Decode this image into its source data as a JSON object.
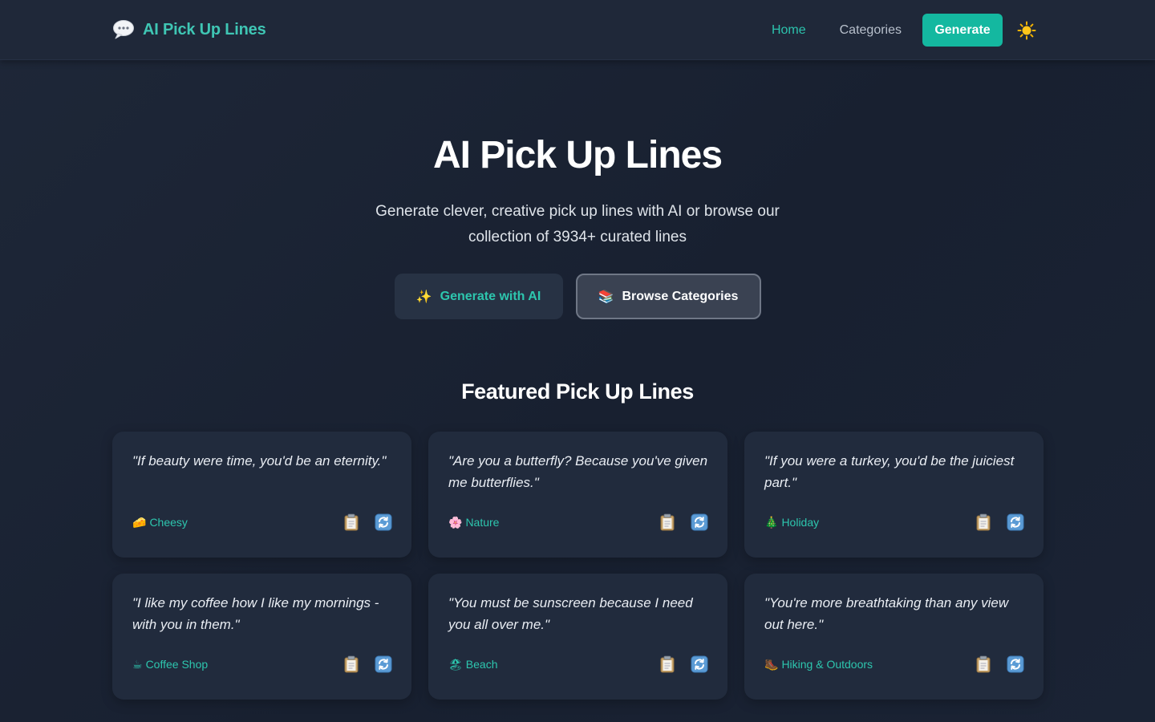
{
  "header": {
    "brand_title": "AI Pick Up Lines",
    "brand_icon": "speech-bubble-icon",
    "nav": {
      "home": "Home",
      "categories": "Categories",
      "generate": "Generate"
    },
    "theme_icon": "sun-icon"
  },
  "hero": {
    "title": "AI Pick Up Lines",
    "subtitle": "Generate clever, creative pick up lines with AI or browse our collection of 3934+ curated lines",
    "generate_button": {
      "icon": "✨",
      "label": "Generate with AI"
    },
    "browse_button": {
      "icon": "📚",
      "label": "Browse Categories"
    }
  },
  "featured": {
    "title": "Featured Pick Up Lines",
    "cards": [
      {
        "quote": "\"If beauty were time, you'd be an eternity.\"",
        "category_icon": "🧀",
        "category": "Cheesy"
      },
      {
        "quote": "\"Are you a butterfly? Because you've given me butterflies.\"",
        "category_icon": "🌸",
        "category": "Nature"
      },
      {
        "quote": "\"If you were a turkey, you'd be the juiciest part.\"",
        "category_icon": "🎄",
        "category": "Holiday"
      },
      {
        "quote": "\"I like my coffee how I like my mornings - with you in them.\"",
        "category_icon": "☕",
        "category": "Coffee Shop"
      },
      {
        "quote": "\"You must be sunscreen because I need you all over me.\"",
        "category_icon": "🏖",
        "category": "Beach"
      },
      {
        "quote": "\"You're more breathtaking than any view out here.\"",
        "category_icon": "🥾",
        "category": "Hiking & Outdoors"
      }
    ]
  },
  "colors": {
    "accent": "#14b8a0",
    "accent_text": "#2dc6ae",
    "background": "#1a2232",
    "card": "#212b3d",
    "header": "#1f2839"
  }
}
